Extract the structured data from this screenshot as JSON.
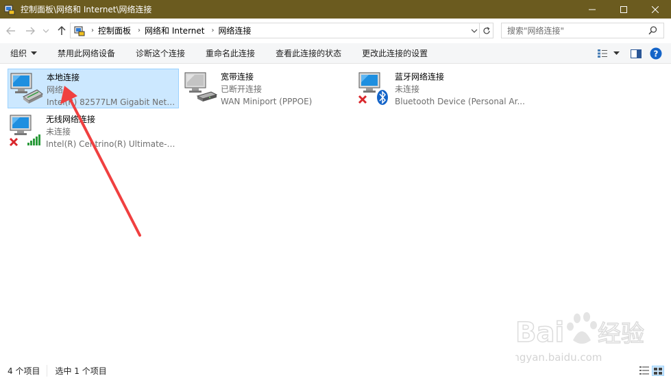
{
  "window": {
    "title": "控制面板\\网络和 Internet\\网络连接",
    "title_bar_color": "#6b5b1f"
  },
  "address": {
    "crumbs": [
      "控制面板",
      "网络和 Internet",
      "网络连接"
    ],
    "search_placeholder": "搜索\"网络连接\""
  },
  "toolbar": {
    "organize": "组织",
    "disable": "禁用此网络设备",
    "diagnose": "诊断这个连接",
    "rename": "重命名此连接",
    "status": "查看此连接的状态",
    "settings": "更改此连接的设置"
  },
  "connections": [
    {
      "name": "本地连接",
      "status": "网络",
      "device": "Intel(R) 82577LM Gigabit Netw...",
      "selected": true
    },
    {
      "name": "宽带连接",
      "status": "已断开连接",
      "device": "WAN Miniport (PPPOE)"
    },
    {
      "name": "蓝牙网络连接",
      "status": "未连接",
      "device": "Bluetooth Device (Personal Ar..."
    },
    {
      "name": "无线网络连接",
      "status": "未连接",
      "device": "Intel(R) Centrino(R) Ultimate-N..."
    }
  ],
  "statusbar": {
    "count": "4 个项目",
    "selected": "选中 1 个项目"
  },
  "watermark": {
    "brand": "Bai",
    "brand2": "经验",
    "url": "jingyan.baidu.com"
  },
  "colors": {
    "selection_bg": "#cce8ff",
    "selection_border": "#99d1ff",
    "arrow": "#f04040",
    "status_error": "#d9262b",
    "bluetooth": "#1464c8"
  }
}
